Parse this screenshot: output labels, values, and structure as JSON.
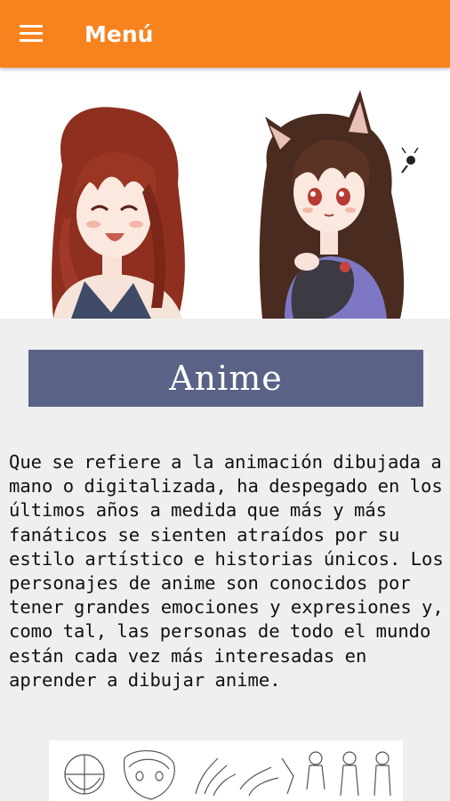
{
  "appbar": {
    "title": "Menú",
    "menu_icon": "hamburger-menu-icon",
    "background_color": "#f7831f"
  },
  "hero": {
    "image": "anime-girls-illustration"
  },
  "banner": {
    "title": "Anime",
    "background_color": "#5a6387"
  },
  "description": {
    "text": "Que se refiere a la animación dibujada a mano o digitalizada, ha despegado en los últimos años a medida que más y más fanáticos se sienten atraídos por su estilo artístico e historias únicos. Los personajes de anime son conocidos por tener grandes emociones y expresiones y, como tal, las personas de todo el mundo están cada vez más interesadas en aprender a dibujar anime."
  },
  "sketch": {
    "image": "anime-sketch-tutorial-illustration"
  }
}
